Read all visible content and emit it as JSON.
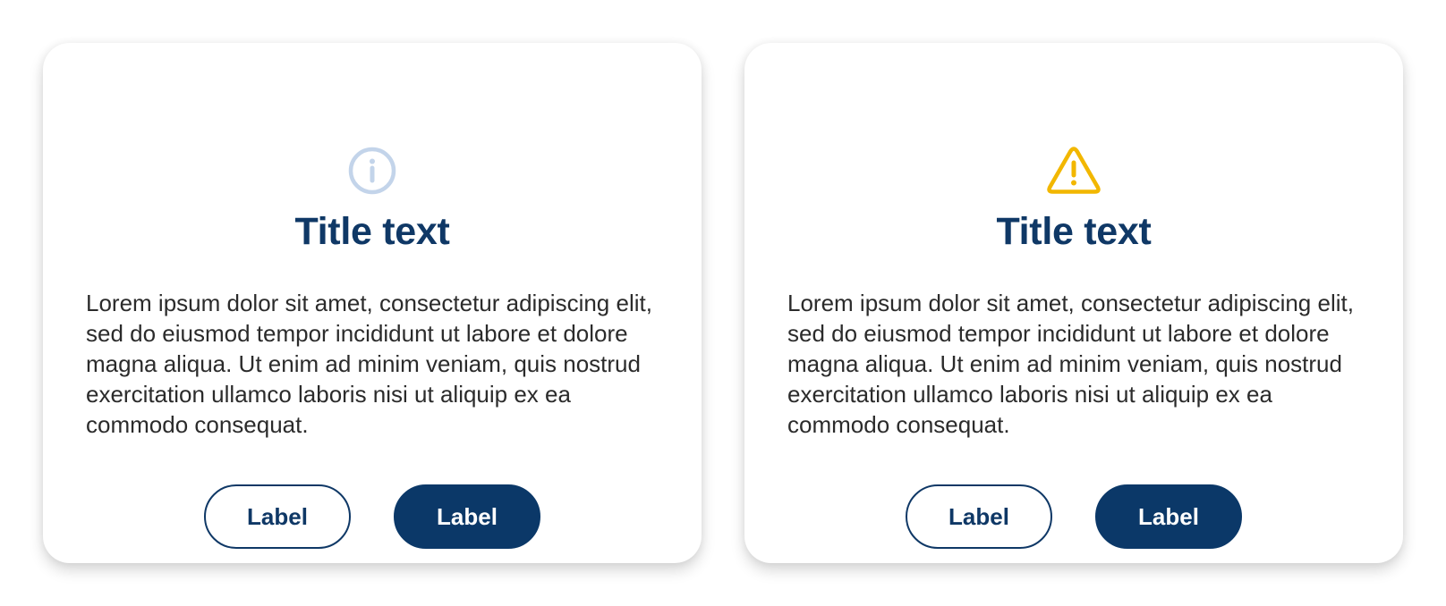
{
  "cards": [
    {
      "icon": "info-circle-icon",
      "icon_color": "#c3d4ea",
      "title": "Title text",
      "body": "Lorem ipsum dolor sit amet, consectetur adipiscing elit, sed do eiusmod tempor incididunt ut labore et dolore magna aliqua. Ut enim ad minim veniam, quis nostrud exercitation ullamco laboris nisi ut aliquip ex ea commodo consequat.",
      "secondary_label": "Label",
      "primary_label": "Label"
    },
    {
      "icon": "warning-triangle-icon",
      "icon_color": "#f2b700",
      "title": "Title text",
      "body": "Lorem ipsum dolor sit amet, consectetur adipiscing elit, sed do eiusmod tempor incididunt ut labore et dolore magna aliqua. Ut enim ad minim veniam, quis nostrud exercitation ullamco laboris nisi ut aliquip ex ea commodo consequat.",
      "secondary_label": "Label",
      "primary_label": "Label"
    }
  ],
  "colors": {
    "title": "#0f3866",
    "primary_button": "#0b3868",
    "body_text": "#2b2b2b"
  }
}
